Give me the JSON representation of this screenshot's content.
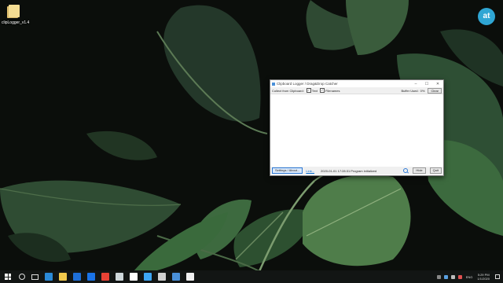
{
  "desktop": {
    "icon_label": "clipLogger_v1.4"
  },
  "brand": {
    "text": "at",
    "color": "#2fa6d4"
  },
  "window": {
    "title": "Clipboard Logger / Drag&Drop Catcher",
    "controls": {
      "minimize": "–",
      "maximize": "☐",
      "close": "✕"
    },
    "options": {
      "collect_label": "Collect from Clipboard:",
      "text_label": "Text",
      "text_checked": true,
      "filenames_label": "Filenames",
      "filenames_checked": true,
      "buffer_label": "Buffer Used:",
      "buffer_value": "0%",
      "clear_label": "Clear"
    },
    "footer": {
      "settings_label": "Settings / About...",
      "link_label": "Link...",
      "status_text": "2020-01-01 17:28:31 Program initialized",
      "hide_label": "Hide",
      "quit_label": "Quit"
    }
  },
  "taskbar": {
    "apps": [
      {
        "name": "edge-icon",
        "color": "#2b8ad8"
      },
      {
        "name": "file-explorer-icon",
        "color": "#f2c94c"
      },
      {
        "name": "store-icon",
        "color": "#1e6fd9"
      },
      {
        "name": "mail-icon",
        "color": "#1a73e8"
      },
      {
        "name": "chrome-icon",
        "color": "#e94235"
      },
      {
        "name": "steam-icon",
        "color": "#cfd8dc"
      },
      {
        "name": "document-icon",
        "color": "#ffffff"
      },
      {
        "name": "media-icon",
        "color": "#3da6f5"
      },
      {
        "name": "terminal-icon",
        "color": "#d0d0d0"
      },
      {
        "name": "clipboard-logger-icon",
        "color": "#4a90d9"
      },
      {
        "name": "notepad-icon",
        "color": "#f0f0f0"
      }
    ],
    "tray": {
      "language": "ENG",
      "time": "5:29 PM",
      "date": "1/1/2020"
    }
  }
}
